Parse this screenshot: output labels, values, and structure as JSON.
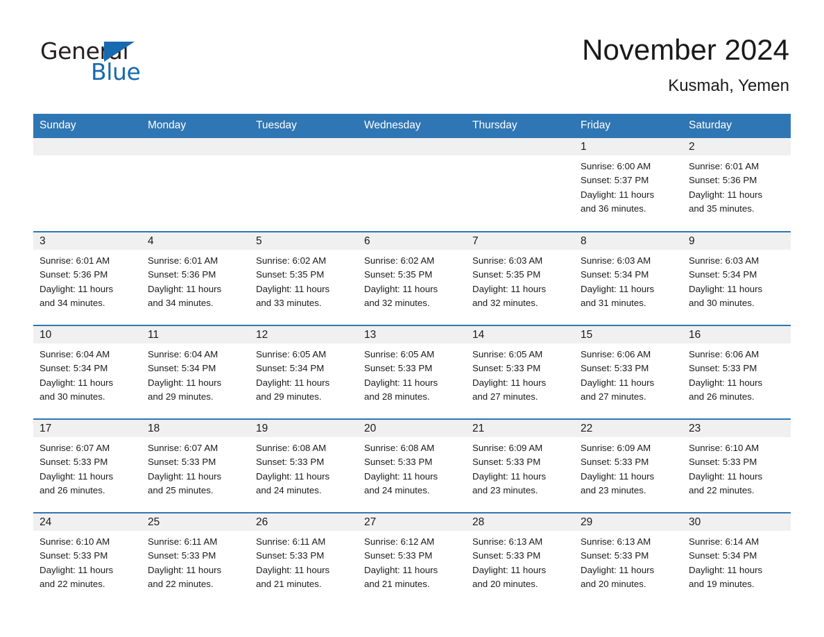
{
  "brand": {
    "name_part1": "General",
    "name_part2": "Blue",
    "accent_color": "#1769b0"
  },
  "header": {
    "month_title": "November 2024",
    "location": "Kusmah, Yemen",
    "header_bg_color": "#2f76b4",
    "daynum_bg_color": "#f0f0f0"
  },
  "weekdays": [
    "Sunday",
    "Monday",
    "Tuesday",
    "Wednesday",
    "Thursday",
    "Friday",
    "Saturday"
  ],
  "weeks": [
    [
      {
        "day": "",
        "sunrise": "",
        "sunset": "",
        "daylight_line1": "",
        "daylight_line2": ""
      },
      {
        "day": "",
        "sunrise": "",
        "sunset": "",
        "daylight_line1": "",
        "daylight_line2": ""
      },
      {
        "day": "",
        "sunrise": "",
        "sunset": "",
        "daylight_line1": "",
        "daylight_line2": ""
      },
      {
        "day": "",
        "sunrise": "",
        "sunset": "",
        "daylight_line1": "",
        "daylight_line2": ""
      },
      {
        "day": "",
        "sunrise": "",
        "sunset": "",
        "daylight_line1": "",
        "daylight_line2": ""
      },
      {
        "day": "1",
        "sunrise": "Sunrise: 6:00 AM",
        "sunset": "Sunset: 5:37 PM",
        "daylight_line1": "Daylight: 11 hours",
        "daylight_line2": "and 36 minutes."
      },
      {
        "day": "2",
        "sunrise": "Sunrise: 6:01 AM",
        "sunset": "Sunset: 5:36 PM",
        "daylight_line1": "Daylight: 11 hours",
        "daylight_line2": "and 35 minutes."
      }
    ],
    [
      {
        "day": "3",
        "sunrise": "Sunrise: 6:01 AM",
        "sunset": "Sunset: 5:36 PM",
        "daylight_line1": "Daylight: 11 hours",
        "daylight_line2": "and 34 minutes."
      },
      {
        "day": "4",
        "sunrise": "Sunrise: 6:01 AM",
        "sunset": "Sunset: 5:36 PM",
        "daylight_line1": "Daylight: 11 hours",
        "daylight_line2": "and 34 minutes."
      },
      {
        "day": "5",
        "sunrise": "Sunrise: 6:02 AM",
        "sunset": "Sunset: 5:35 PM",
        "daylight_line1": "Daylight: 11 hours",
        "daylight_line2": "and 33 minutes."
      },
      {
        "day": "6",
        "sunrise": "Sunrise: 6:02 AM",
        "sunset": "Sunset: 5:35 PM",
        "daylight_line1": "Daylight: 11 hours",
        "daylight_line2": "and 32 minutes."
      },
      {
        "day": "7",
        "sunrise": "Sunrise: 6:03 AM",
        "sunset": "Sunset: 5:35 PM",
        "daylight_line1": "Daylight: 11 hours",
        "daylight_line2": "and 32 minutes."
      },
      {
        "day": "8",
        "sunrise": "Sunrise: 6:03 AM",
        "sunset": "Sunset: 5:34 PM",
        "daylight_line1": "Daylight: 11 hours",
        "daylight_line2": "and 31 minutes."
      },
      {
        "day": "9",
        "sunrise": "Sunrise: 6:03 AM",
        "sunset": "Sunset: 5:34 PM",
        "daylight_line1": "Daylight: 11 hours",
        "daylight_line2": "and 30 minutes."
      }
    ],
    [
      {
        "day": "10",
        "sunrise": "Sunrise: 6:04 AM",
        "sunset": "Sunset: 5:34 PM",
        "daylight_line1": "Daylight: 11 hours",
        "daylight_line2": "and 30 minutes."
      },
      {
        "day": "11",
        "sunrise": "Sunrise: 6:04 AM",
        "sunset": "Sunset: 5:34 PM",
        "daylight_line1": "Daylight: 11 hours",
        "daylight_line2": "and 29 minutes."
      },
      {
        "day": "12",
        "sunrise": "Sunrise: 6:05 AM",
        "sunset": "Sunset: 5:34 PM",
        "daylight_line1": "Daylight: 11 hours",
        "daylight_line2": "and 29 minutes."
      },
      {
        "day": "13",
        "sunrise": "Sunrise: 6:05 AM",
        "sunset": "Sunset: 5:33 PM",
        "daylight_line1": "Daylight: 11 hours",
        "daylight_line2": "and 28 minutes."
      },
      {
        "day": "14",
        "sunrise": "Sunrise: 6:05 AM",
        "sunset": "Sunset: 5:33 PM",
        "daylight_line1": "Daylight: 11 hours",
        "daylight_line2": "and 27 minutes."
      },
      {
        "day": "15",
        "sunrise": "Sunrise: 6:06 AM",
        "sunset": "Sunset: 5:33 PM",
        "daylight_line1": "Daylight: 11 hours",
        "daylight_line2": "and 27 minutes."
      },
      {
        "day": "16",
        "sunrise": "Sunrise: 6:06 AM",
        "sunset": "Sunset: 5:33 PM",
        "daylight_line1": "Daylight: 11 hours",
        "daylight_line2": "and 26 minutes."
      }
    ],
    [
      {
        "day": "17",
        "sunrise": "Sunrise: 6:07 AM",
        "sunset": "Sunset: 5:33 PM",
        "daylight_line1": "Daylight: 11 hours",
        "daylight_line2": "and 26 minutes."
      },
      {
        "day": "18",
        "sunrise": "Sunrise: 6:07 AM",
        "sunset": "Sunset: 5:33 PM",
        "daylight_line1": "Daylight: 11 hours",
        "daylight_line2": "and 25 minutes."
      },
      {
        "day": "19",
        "sunrise": "Sunrise: 6:08 AM",
        "sunset": "Sunset: 5:33 PM",
        "daylight_line1": "Daylight: 11 hours",
        "daylight_line2": "and 24 minutes."
      },
      {
        "day": "20",
        "sunrise": "Sunrise: 6:08 AM",
        "sunset": "Sunset: 5:33 PM",
        "daylight_line1": "Daylight: 11 hours",
        "daylight_line2": "and 24 minutes."
      },
      {
        "day": "21",
        "sunrise": "Sunrise: 6:09 AM",
        "sunset": "Sunset: 5:33 PM",
        "daylight_line1": "Daylight: 11 hours",
        "daylight_line2": "and 23 minutes."
      },
      {
        "day": "22",
        "sunrise": "Sunrise: 6:09 AM",
        "sunset": "Sunset: 5:33 PM",
        "daylight_line1": "Daylight: 11 hours",
        "daylight_line2": "and 23 minutes."
      },
      {
        "day": "23",
        "sunrise": "Sunrise: 6:10 AM",
        "sunset": "Sunset: 5:33 PM",
        "daylight_line1": "Daylight: 11 hours",
        "daylight_line2": "and 22 minutes."
      }
    ],
    [
      {
        "day": "24",
        "sunrise": "Sunrise: 6:10 AM",
        "sunset": "Sunset: 5:33 PM",
        "daylight_line1": "Daylight: 11 hours",
        "daylight_line2": "and 22 minutes."
      },
      {
        "day": "25",
        "sunrise": "Sunrise: 6:11 AM",
        "sunset": "Sunset: 5:33 PM",
        "daylight_line1": "Daylight: 11 hours",
        "daylight_line2": "and 22 minutes."
      },
      {
        "day": "26",
        "sunrise": "Sunrise: 6:11 AM",
        "sunset": "Sunset: 5:33 PM",
        "daylight_line1": "Daylight: 11 hours",
        "daylight_line2": "and 21 minutes."
      },
      {
        "day": "27",
        "sunrise": "Sunrise: 6:12 AM",
        "sunset": "Sunset: 5:33 PM",
        "daylight_line1": "Daylight: 11 hours",
        "daylight_line2": "and 21 minutes."
      },
      {
        "day": "28",
        "sunrise": "Sunrise: 6:13 AM",
        "sunset": "Sunset: 5:33 PM",
        "daylight_line1": "Daylight: 11 hours",
        "daylight_line2": "and 20 minutes."
      },
      {
        "day": "29",
        "sunrise": "Sunrise: 6:13 AM",
        "sunset": "Sunset: 5:33 PM",
        "daylight_line1": "Daylight: 11 hours",
        "daylight_line2": "and 20 minutes."
      },
      {
        "day": "30",
        "sunrise": "Sunrise: 6:14 AM",
        "sunset": "Sunset: 5:34 PM",
        "daylight_line1": "Daylight: 11 hours",
        "daylight_line2": "and 19 minutes."
      }
    ]
  ]
}
